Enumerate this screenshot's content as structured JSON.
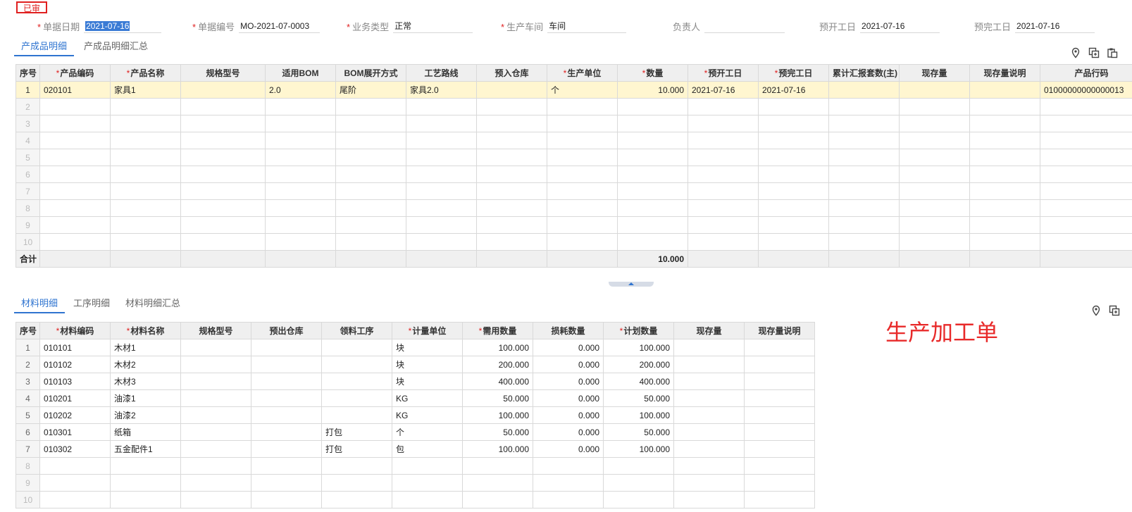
{
  "status_badge": "已审",
  "header": {
    "fields": [
      {
        "label": "单据日期",
        "value": "2021-07-16",
        "required": true
      },
      {
        "label": "单据编号",
        "value": "MO-2021-07-0003",
        "required": true
      },
      {
        "label": "业务类型",
        "value": "正常",
        "required": true
      },
      {
        "label": "生产车间",
        "value": "车间",
        "required": true
      },
      {
        "label": "负责人",
        "value": "",
        "required": false
      },
      {
        "label": "预开工日",
        "value": "2021-07-16",
        "required": false
      },
      {
        "label": "预完工日",
        "value": "2021-07-16",
        "required": false
      }
    ]
  },
  "product_tabs": [
    "产成品明细",
    "产成品明细汇总"
  ],
  "product_table": {
    "columns": [
      {
        "label": "序号",
        "required": false
      },
      {
        "label": "产品编码",
        "required": true
      },
      {
        "label": "产品名称",
        "required": true
      },
      {
        "label": "规格型号",
        "required": false
      },
      {
        "label": "适用BOM",
        "required": false
      },
      {
        "label": "BOM展开方式",
        "required": false
      },
      {
        "label": "工艺路线",
        "required": false
      },
      {
        "label": "预入仓库",
        "required": false
      },
      {
        "label": "生产单位",
        "required": true
      },
      {
        "label": "数量",
        "required": true
      },
      {
        "label": "预开工日",
        "required": true
      },
      {
        "label": "预完工日",
        "required": true
      },
      {
        "label": "累计汇报套数(主)",
        "required": false
      },
      {
        "label": "现存量",
        "required": false
      },
      {
        "label": "现存量说明",
        "required": false
      },
      {
        "label": "产品行码",
        "required": false
      }
    ],
    "rows": [
      [
        "1",
        "020101",
        "家具1",
        "",
        "2.0",
        "尾阶",
        "家具2.0",
        "",
        "个",
        "10.000",
        "2021-07-16",
        "2021-07-16",
        "",
        "",
        "",
        "01000000000000013"
      ],
      [
        "2"
      ],
      [
        "3"
      ],
      [
        "4"
      ],
      [
        "5"
      ],
      [
        "6"
      ],
      [
        "7"
      ],
      [
        "8"
      ],
      [
        "9"
      ],
      [
        "10"
      ]
    ],
    "total_label": "合计",
    "total_quantity": "10.000"
  },
  "material_tabs": [
    "材料明细",
    "工序明细",
    "材料明细汇总"
  ],
  "material_table": {
    "columns": [
      {
        "label": "序号",
        "required": false
      },
      {
        "label": "材料编码",
        "required": true
      },
      {
        "label": "材料名称",
        "required": true
      },
      {
        "label": "规格型号",
        "required": false
      },
      {
        "label": "预出仓库",
        "required": false
      },
      {
        "label": "领料工序",
        "required": false
      },
      {
        "label": "计量单位",
        "required": true
      },
      {
        "label": "需用数量",
        "required": true
      },
      {
        "label": "损耗数量",
        "required": false
      },
      {
        "label": "计划数量",
        "required": true
      },
      {
        "label": "现存量",
        "required": false
      },
      {
        "label": "现存量说明",
        "required": false
      }
    ],
    "rows": [
      [
        "1",
        "010101",
        "木材1",
        "",
        "",
        "",
        "块",
        "100.000",
        "0.000",
        "100.000",
        "",
        ""
      ],
      [
        "2",
        "010102",
        "木材2",
        "",
        "",
        "",
        "块",
        "200.000",
        "0.000",
        "200.000",
        "",
        ""
      ],
      [
        "3",
        "010103",
        "木材3",
        "",
        "",
        "",
        "块",
        "400.000",
        "0.000",
        "400.000",
        "",
        ""
      ],
      [
        "4",
        "010201",
        "油漆1",
        "",
        "",
        "",
        "KG",
        "50.000",
        "0.000",
        "50.000",
        "",
        ""
      ],
      [
        "5",
        "010202",
        "油漆2",
        "",
        "",
        "",
        "KG",
        "100.000",
        "0.000",
        "100.000",
        "",
        ""
      ],
      [
        "6",
        "010301",
        "纸箱",
        "",
        "",
        "打包",
        "个",
        "50.000",
        "0.000",
        "50.000",
        "",
        ""
      ],
      [
        "7",
        "010302",
        "五金配件1",
        "",
        "",
        "打包",
        "包",
        "100.000",
        "0.000",
        "100.000",
        "",
        ""
      ],
      [
        "8"
      ],
      [
        "9"
      ],
      [
        "10"
      ]
    ]
  },
  "overlay_title": "生产加工单",
  "toolbar_icons": [
    "location-pin-icon",
    "copy-row-icon",
    "paste-row-icon"
  ],
  "colors": {
    "accent": "#2f74d0",
    "required": "#e02020",
    "highlight_row": "#fff6d0",
    "title": "#e82a2a"
  }
}
